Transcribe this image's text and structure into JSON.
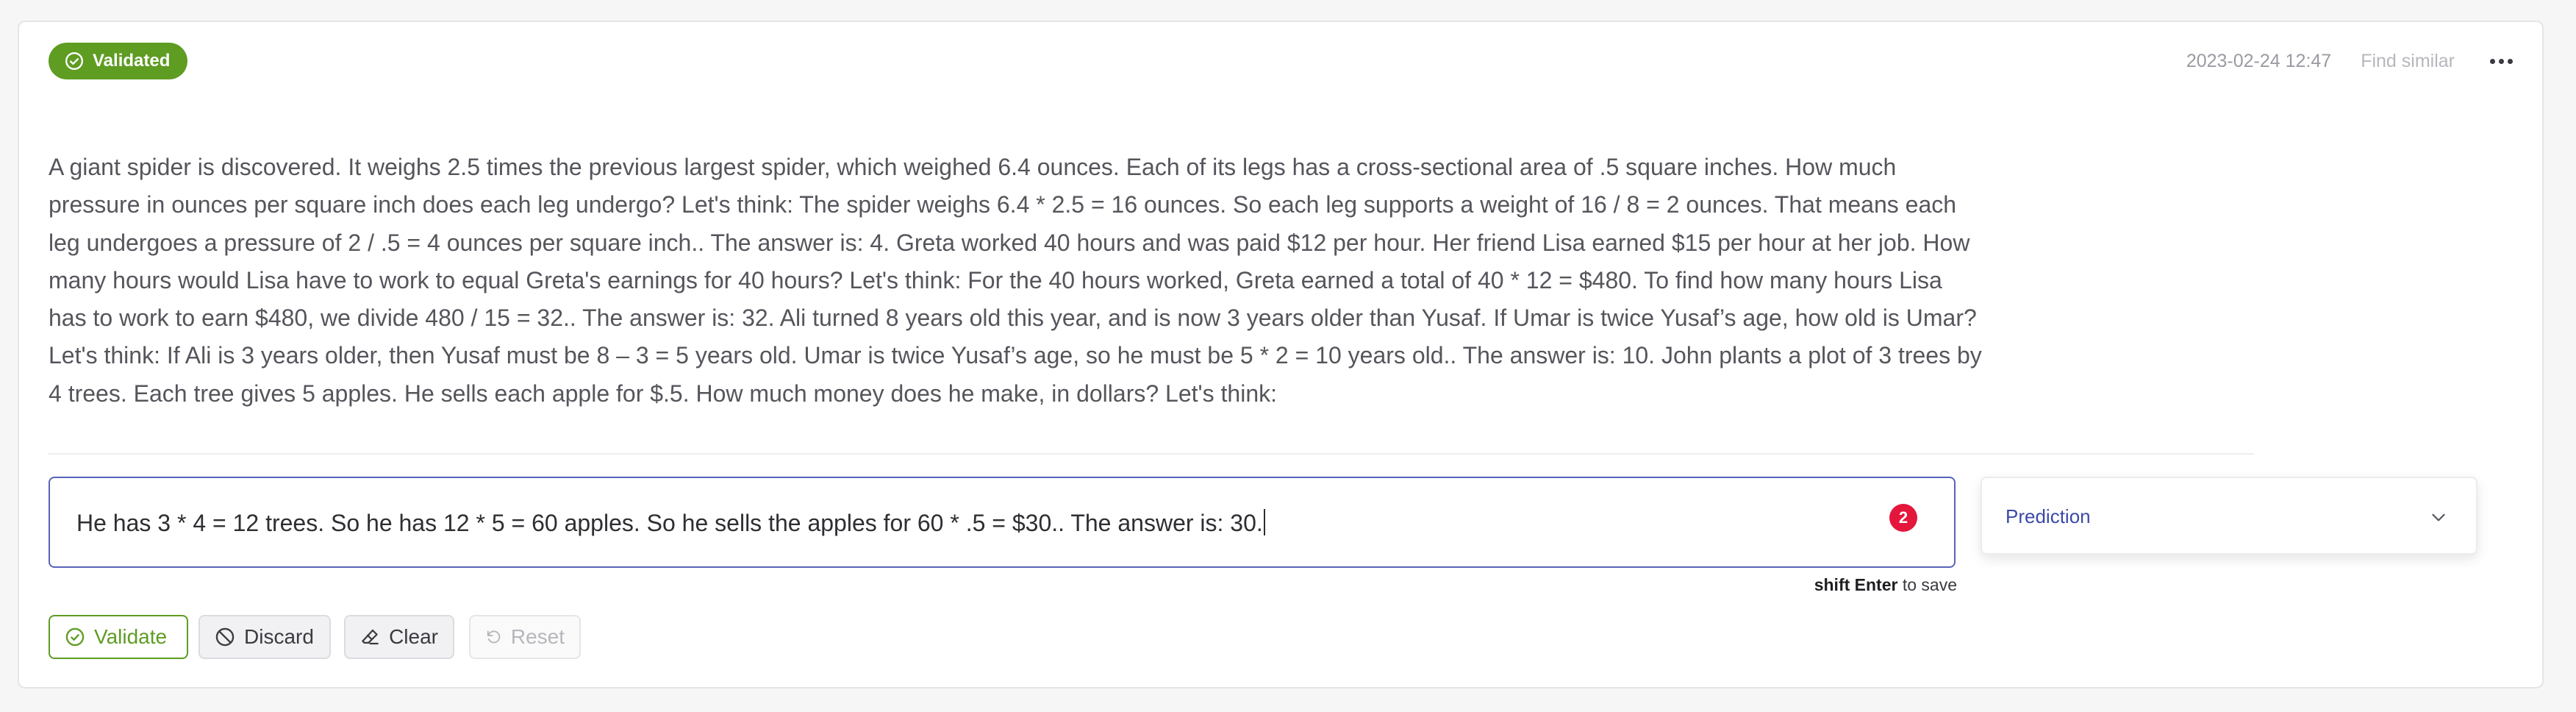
{
  "status": {
    "label": "Validated",
    "color": "#5e9c22",
    "icon": "check-circle-icon"
  },
  "header": {
    "timestamp": "2023-02-24 12:47",
    "find_similar": "Find similar",
    "more_icon": "more-horizontal-icon"
  },
  "record": {
    "prompt": "A giant spider is discovered. It weighs 2.5 times the previous largest spider, which weighed 6.4 ounces. Each of its legs has a cross-sectional area of .5 square inches. How much pressure in ounces per square inch does each leg undergo? Let's think: The spider weighs 6.4 * 2.5 = 16 ounces. So each leg supports a weight of 16 / 8 = 2 ounces. That means each leg undergoes a pressure of 2 / .5 = 4 ounces per square inch.. The answer is: 4. Greta worked 40 hours and was paid $12 per hour. Her friend Lisa earned $15 per hour at her job. How many hours would Lisa have to work to equal Greta's earnings for 40 hours? Let's think: For the 40 hours worked, Greta earned a total of 40 * 12 = $480. To find how many hours Lisa has to work to earn $480, we divide 480 / 15 = 32.. The answer is: 32. Ali turned 8 years old this year, and is now 3 years older than Yusaf. If Umar is twice Yusaf’s age, how old is Umar? Let's think: If Ali is 3 years older, then Yusaf must be 8 – 3 = 5 years old. Umar is twice Yusaf’s age, so he must be 5 * 2 = 10 years old.. The answer is: 10. John plants a plot of 3 trees by 4 trees. Each tree gives 5 apples. He sells each apple for $.5. How much money does he make, in dollars? Let's think:"
  },
  "annotation": {
    "value": "He has 3 * 4 = 12 trees. So he has 12 * 5 = 60 apples. So he sells the apples for 60 * .5 = $30.. The answer is: 30.",
    "spellcheck_count": "2",
    "save_hint_key": "shift Enter",
    "save_hint_text": "to save"
  },
  "prediction": {
    "label": "Prediction",
    "chevron_icon": "chevron-down-icon"
  },
  "actions": {
    "validate": "Validate",
    "discard": "Discard",
    "clear": "Clear",
    "reset": "Reset"
  }
}
